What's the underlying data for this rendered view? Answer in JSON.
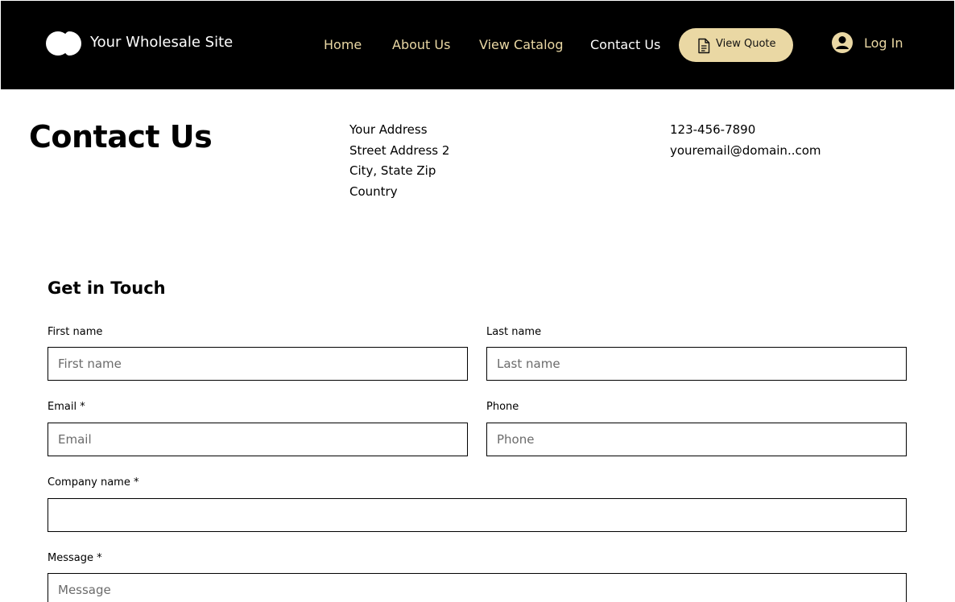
{
  "header": {
    "site_name": "Your Wholesale Site",
    "nav": [
      {
        "label": "Home"
      },
      {
        "label": "About Us"
      },
      {
        "label": "View Catalog"
      },
      {
        "label": "Contact Us",
        "active": true
      }
    ],
    "quote_button": {
      "label": "View Quote",
      "icon": "document-icon"
    },
    "login": {
      "label": "Log In",
      "icon": "avatar-icon"
    },
    "colors": {
      "background": "#000000",
      "accent": "#ead8a4",
      "active": "#ffffff"
    }
  },
  "page_title": "Contact Us",
  "address": [
    "Your Address",
    "Street Address 2",
    "City, State Zip",
    "Country"
  ],
  "contact": {
    "phone": "123-456-7890",
    "email": "youremail@domain..com"
  },
  "form": {
    "title": "Get in Touch",
    "fields": {
      "first_name": {
        "label": "First name",
        "placeholder": "First name"
      },
      "last_name": {
        "label": "Last name",
        "placeholder": "Last name"
      },
      "email": {
        "label": "Email *",
        "placeholder": "Email"
      },
      "phone": {
        "label": "Phone",
        "placeholder": "Phone"
      },
      "company": {
        "label": "Company name *",
        "placeholder": ""
      },
      "message": {
        "label": "Message *",
        "placeholder": "Message"
      }
    }
  }
}
